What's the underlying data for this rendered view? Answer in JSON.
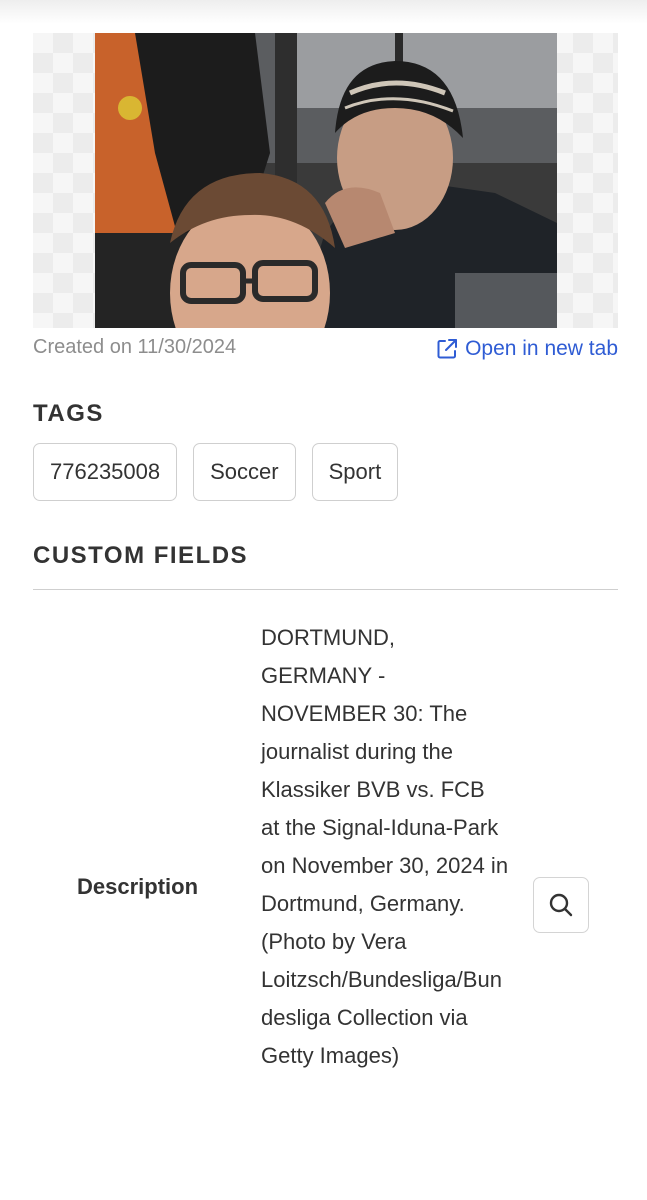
{
  "image": {
    "alt_icon": "photo"
  },
  "meta": {
    "created": "Created on 11/30/2024",
    "open_link": "Open in new tab"
  },
  "tags_section": {
    "title": "TAGS",
    "tags": [
      "776235008",
      "Soccer",
      "Sport"
    ]
  },
  "custom_fields": {
    "title": "CUSTOM FIELDS",
    "fields": [
      {
        "label": "Description",
        "value": "DORTMUND, GERMANY - NOVEMBER 30: The journalist during the Klassiker BVB vs. FCB at the Signal-Iduna-Park on November 30, 2024 in Dortmund, Germany. (Photo by Vera Loitzsch/Bundesliga/Bundesliga Collection via Getty Images)"
      }
    ]
  },
  "colors": {
    "link": "#2f5cd4",
    "muted_text": "#8d8d8d",
    "border": "#cfcfcf"
  }
}
